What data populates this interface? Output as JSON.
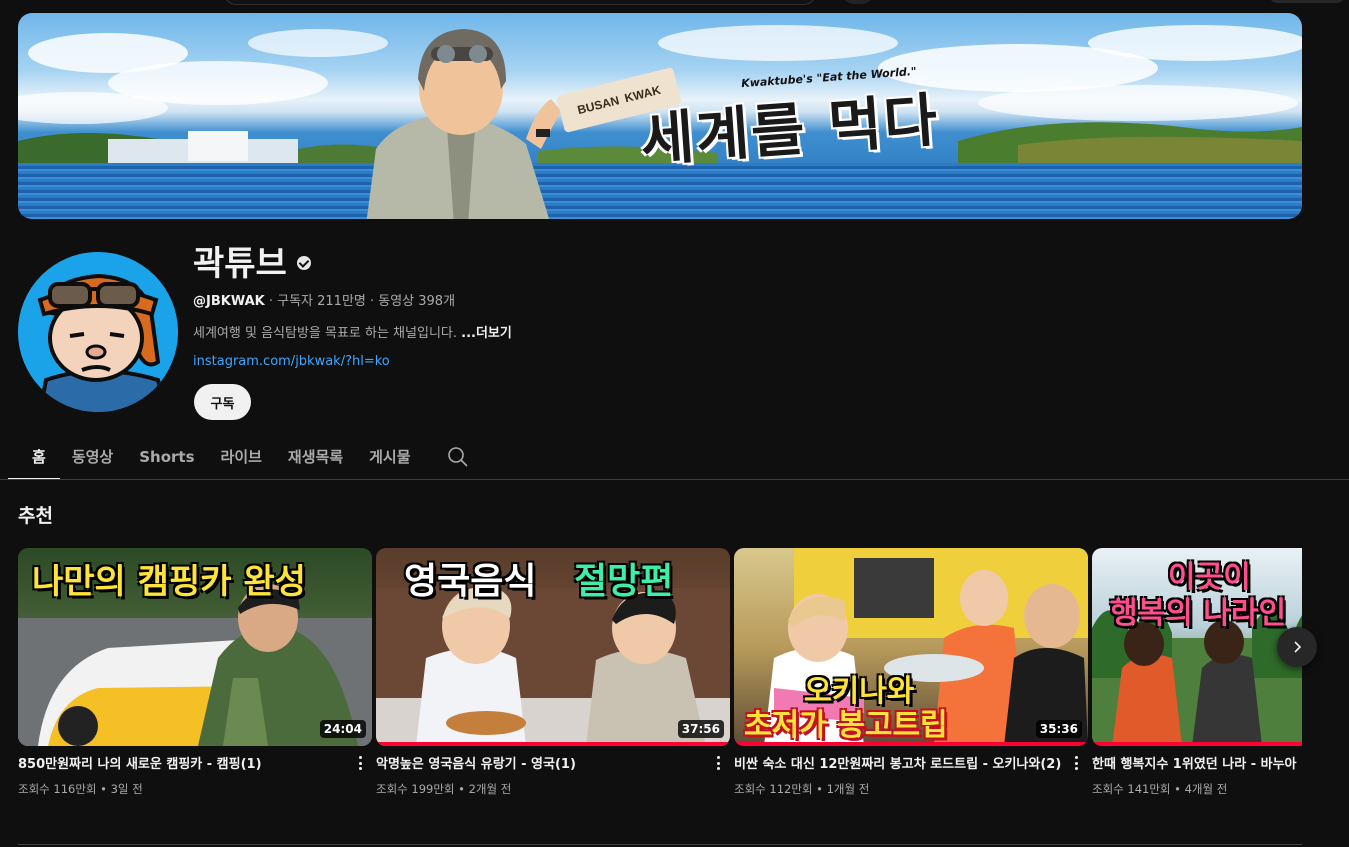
{
  "banner": {
    "subtitle": "Kwaktube's \"Eat the World.\"",
    "title": "세계를 먹다",
    "tag_left": "BUSAN",
    "tag_right": "KWAK"
  },
  "channel": {
    "name": "곽튜브",
    "handle": "@JBKWAK",
    "stats": " · 구독자 211만명 · 동영상 398개",
    "description": "세계여행 및 음식탐방을 목표로 하는 채널입니다.",
    "more_label": "...더보기",
    "link": "instagram.com/jbkwak/?hl=ko",
    "subscribe_label": "구독"
  },
  "tabs": [
    {
      "label": "홈",
      "active": true
    },
    {
      "label": "동영상"
    },
    {
      "label": "Shorts"
    },
    {
      "label": "라이브"
    },
    {
      "label": "재생목록"
    },
    {
      "label": "게시물"
    }
  ],
  "section": {
    "title": "추천"
  },
  "videos": [
    {
      "title": "850만원짜리 나의 새로운 캠핑카 - 캠핑(1)",
      "meta": "조회수 116만회 • 3일 전",
      "duration": "24:04",
      "thumb_text": "나만의 캠핑카 완성",
      "watched": 0
    },
    {
      "title": "악명높은 영국음식 유랑기 - 영국(1)",
      "meta": "조회수 199만회 • 2개월 전",
      "duration": "37:56",
      "thumb_text_a": "영국음식",
      "thumb_text_b": "절망편",
      "watched": 1.0
    },
    {
      "title": "비싼 숙소 대신 12만원짜리 봉고차 로드트립 - 오키나와(2)",
      "meta": "조회수 112만회 • 1개월 전",
      "duration": "35:36",
      "thumb_text_a": "오키나와",
      "thumb_text_b": "초저가 봉고트립",
      "watched": 1.0
    },
    {
      "title": "한때 행복지수 1위였던 나라 - 바누아",
      "meta": "조회수 141만회 • 4개월 전",
      "thumb_text_a": "이곳이",
      "thumb_text_b": "행복의 나라인",
      "watched": 1.0
    }
  ]
}
